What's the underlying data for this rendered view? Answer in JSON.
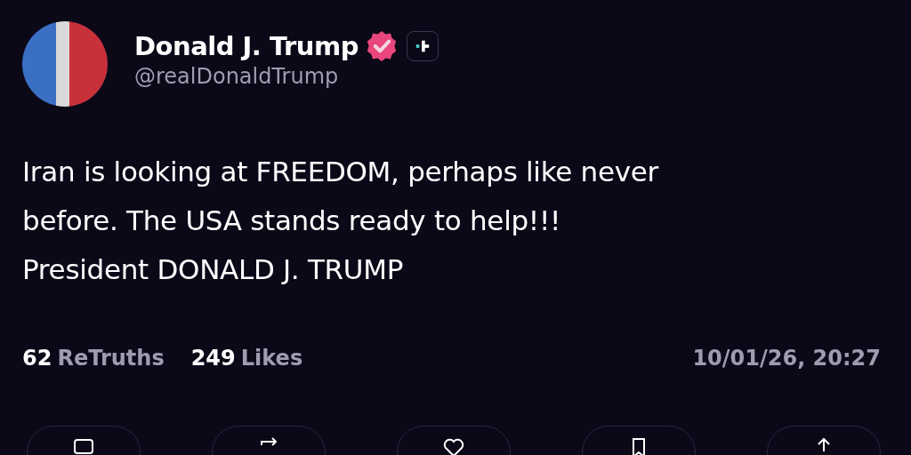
{
  "author": {
    "name": "Donald J. Trump",
    "handle": "@realDonaldTrump",
    "verified": true
  },
  "post": {
    "lines": [
      "Iran is looking at FREEDOM, perhaps like never",
      "before. The USA stands ready to help!!!",
      "President DONALD J. TRUMP"
    ]
  },
  "stats": [
    {
      "count": "62",
      "label": "ReTruths"
    },
    {
      "count": "249",
      "label": "Likes"
    }
  ],
  "timestamp": "10/01/26, 20:27",
  "actions": [
    {
      "kind": "reply"
    },
    {
      "kind": "retruth"
    },
    {
      "kind": "like"
    },
    {
      "kind": "bookmark"
    },
    {
      "kind": "share"
    }
  ]
}
